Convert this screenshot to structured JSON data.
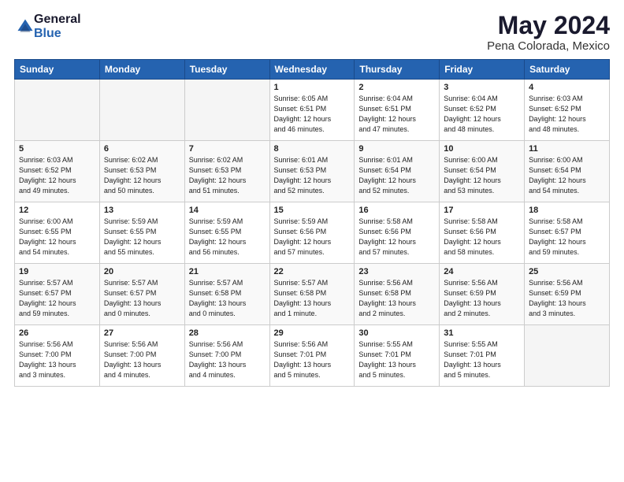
{
  "logo": {
    "general": "General",
    "blue": "Blue"
  },
  "title": "May 2024",
  "location": "Pena Colorada, Mexico",
  "days_of_week": [
    "Sunday",
    "Monday",
    "Tuesday",
    "Wednesday",
    "Thursday",
    "Friday",
    "Saturday"
  ],
  "weeks": [
    [
      {
        "day": "",
        "info": ""
      },
      {
        "day": "",
        "info": ""
      },
      {
        "day": "",
        "info": ""
      },
      {
        "day": "1",
        "info": "Sunrise: 6:05 AM\nSunset: 6:51 PM\nDaylight: 12 hours\nand 46 minutes."
      },
      {
        "day": "2",
        "info": "Sunrise: 6:04 AM\nSunset: 6:51 PM\nDaylight: 12 hours\nand 47 minutes."
      },
      {
        "day": "3",
        "info": "Sunrise: 6:04 AM\nSunset: 6:52 PM\nDaylight: 12 hours\nand 48 minutes."
      },
      {
        "day": "4",
        "info": "Sunrise: 6:03 AM\nSunset: 6:52 PM\nDaylight: 12 hours\nand 48 minutes."
      }
    ],
    [
      {
        "day": "5",
        "info": "Sunrise: 6:03 AM\nSunset: 6:52 PM\nDaylight: 12 hours\nand 49 minutes."
      },
      {
        "day": "6",
        "info": "Sunrise: 6:02 AM\nSunset: 6:53 PM\nDaylight: 12 hours\nand 50 minutes."
      },
      {
        "day": "7",
        "info": "Sunrise: 6:02 AM\nSunset: 6:53 PM\nDaylight: 12 hours\nand 51 minutes."
      },
      {
        "day": "8",
        "info": "Sunrise: 6:01 AM\nSunset: 6:53 PM\nDaylight: 12 hours\nand 52 minutes."
      },
      {
        "day": "9",
        "info": "Sunrise: 6:01 AM\nSunset: 6:54 PM\nDaylight: 12 hours\nand 52 minutes."
      },
      {
        "day": "10",
        "info": "Sunrise: 6:00 AM\nSunset: 6:54 PM\nDaylight: 12 hours\nand 53 minutes."
      },
      {
        "day": "11",
        "info": "Sunrise: 6:00 AM\nSunset: 6:54 PM\nDaylight: 12 hours\nand 54 minutes."
      }
    ],
    [
      {
        "day": "12",
        "info": "Sunrise: 6:00 AM\nSunset: 6:55 PM\nDaylight: 12 hours\nand 54 minutes."
      },
      {
        "day": "13",
        "info": "Sunrise: 5:59 AM\nSunset: 6:55 PM\nDaylight: 12 hours\nand 55 minutes."
      },
      {
        "day": "14",
        "info": "Sunrise: 5:59 AM\nSunset: 6:55 PM\nDaylight: 12 hours\nand 56 minutes."
      },
      {
        "day": "15",
        "info": "Sunrise: 5:59 AM\nSunset: 6:56 PM\nDaylight: 12 hours\nand 57 minutes."
      },
      {
        "day": "16",
        "info": "Sunrise: 5:58 AM\nSunset: 6:56 PM\nDaylight: 12 hours\nand 57 minutes."
      },
      {
        "day": "17",
        "info": "Sunrise: 5:58 AM\nSunset: 6:56 PM\nDaylight: 12 hours\nand 58 minutes."
      },
      {
        "day": "18",
        "info": "Sunrise: 5:58 AM\nSunset: 6:57 PM\nDaylight: 12 hours\nand 59 minutes."
      }
    ],
    [
      {
        "day": "19",
        "info": "Sunrise: 5:57 AM\nSunset: 6:57 PM\nDaylight: 12 hours\nand 59 minutes."
      },
      {
        "day": "20",
        "info": "Sunrise: 5:57 AM\nSunset: 6:57 PM\nDaylight: 13 hours\nand 0 minutes."
      },
      {
        "day": "21",
        "info": "Sunrise: 5:57 AM\nSunset: 6:58 PM\nDaylight: 13 hours\nand 0 minutes."
      },
      {
        "day": "22",
        "info": "Sunrise: 5:57 AM\nSunset: 6:58 PM\nDaylight: 13 hours\nand 1 minute."
      },
      {
        "day": "23",
        "info": "Sunrise: 5:56 AM\nSunset: 6:58 PM\nDaylight: 13 hours\nand 2 minutes."
      },
      {
        "day": "24",
        "info": "Sunrise: 5:56 AM\nSunset: 6:59 PM\nDaylight: 13 hours\nand 2 minutes."
      },
      {
        "day": "25",
        "info": "Sunrise: 5:56 AM\nSunset: 6:59 PM\nDaylight: 13 hours\nand 3 minutes."
      }
    ],
    [
      {
        "day": "26",
        "info": "Sunrise: 5:56 AM\nSunset: 7:00 PM\nDaylight: 13 hours\nand 3 minutes."
      },
      {
        "day": "27",
        "info": "Sunrise: 5:56 AM\nSunset: 7:00 PM\nDaylight: 13 hours\nand 4 minutes."
      },
      {
        "day": "28",
        "info": "Sunrise: 5:56 AM\nSunset: 7:00 PM\nDaylight: 13 hours\nand 4 minutes."
      },
      {
        "day": "29",
        "info": "Sunrise: 5:56 AM\nSunset: 7:01 PM\nDaylight: 13 hours\nand 5 minutes."
      },
      {
        "day": "30",
        "info": "Sunrise: 5:55 AM\nSunset: 7:01 PM\nDaylight: 13 hours\nand 5 minutes."
      },
      {
        "day": "31",
        "info": "Sunrise: 5:55 AM\nSunset: 7:01 PM\nDaylight: 13 hours\nand 5 minutes."
      },
      {
        "day": "",
        "info": ""
      }
    ]
  ]
}
